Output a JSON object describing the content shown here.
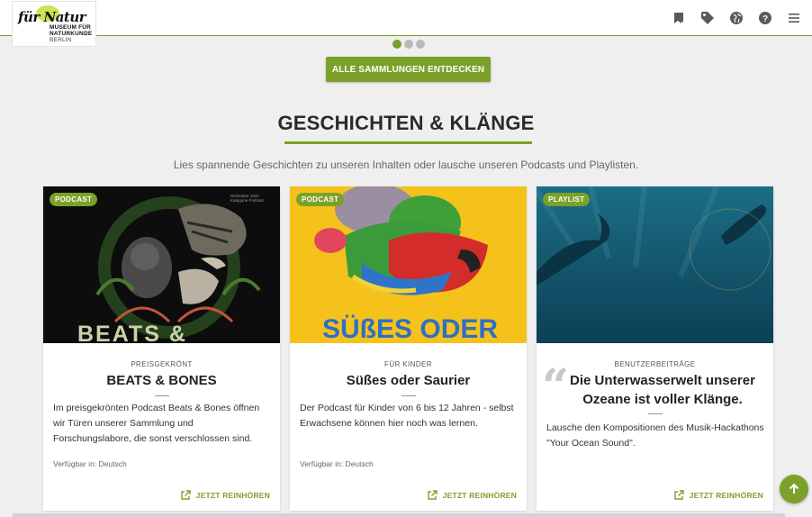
{
  "header": {
    "logo": {
      "script": "für Natur",
      "line1": "MUSEUM FÜR",
      "line2": "NATURKUNDE",
      "line3": "BERLIN"
    },
    "icons": [
      "bookmark-icon",
      "tag-icon",
      "globe-icon",
      "help-icon",
      "menu-icon"
    ]
  },
  "carousel": {
    "dots": 3,
    "active": 0
  },
  "cta_all": "ALLE SAMMLUNGEN ENTDECKEN",
  "section": {
    "title": "GESCHICHTEN & KLÄNGE",
    "subtitle": "Lies spannende Geschichten zu unseren Inhalten oder lausche unseren Podcasts und Playlisten."
  },
  "cards": [
    {
      "badge": "PODCAST",
      "kicker": "PREISGEKRÖNT",
      "title": "BEATS & BONES",
      "image_text": "BEATS & BONES",
      "image_small": "Dezember 2021 Kategorie Podcast",
      "text": "Im preisgekrönten Podcast Beats & Bones öffnen wir Türen unserer Sammlung und Forschungslabore, die sonst verschlossen sind.",
      "availability": "Verfügbar in: Deutsch",
      "cta": "JETZT REINHÖREN"
    },
    {
      "badge": "PODCAST",
      "kicker": "FÜR KINDER",
      "title": "Süßes oder Saurier",
      "image_text": "SÜßES ODER",
      "text": "Der Podcast für Kinder von 6 bis 12 Jahren - selbst Erwachsene können hier noch was lernen.",
      "availability": "Verfügbar in: Deutsch",
      "cta": "JETZT REINHÖREN"
    },
    {
      "badge": "PLAYLIST",
      "kicker": "BENUTZERBEITRÄGE",
      "title": "Die Unterwasserwelt unserer Ozeane ist voller Klänge.",
      "text": "Lausche den Kompositionen des Musik-Hackathons \"Your Ocean Sound\".",
      "cta": "JETZT REINHÖREN"
    }
  ],
  "colors": {
    "accent": "#7ba12a",
    "background": "#efefef"
  }
}
